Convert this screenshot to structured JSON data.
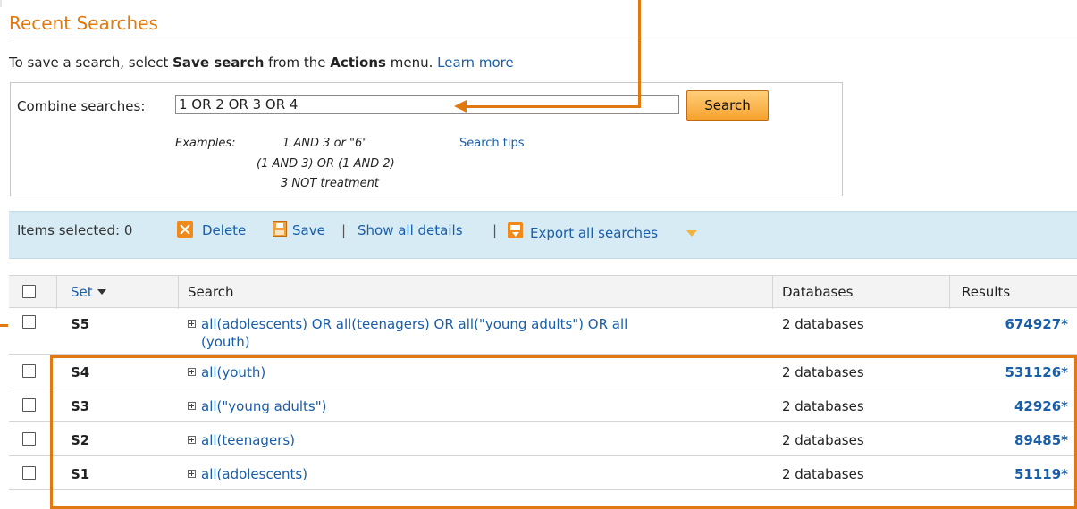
{
  "page": {
    "title": "Recent Searches",
    "intro": {
      "prefix": "To save a search, select ",
      "bold1": "Save search",
      "mid": " from the ",
      "bold2": "Actions",
      "suffix": " menu. ",
      "learn_more": "Learn more"
    }
  },
  "combine": {
    "label": "Combine searches:",
    "value": "1 OR 2 OR 3 OR 4",
    "search_button": "Search",
    "examples_label": "Examples:",
    "examples": [
      "1 AND 3 or \"6\"",
      "(1 AND 3) OR (1 AND 2)",
      "3 NOT treatment"
    ],
    "search_tips": "Search tips"
  },
  "toolbar": {
    "items_selected": "Items selected: 0",
    "delete": "Delete",
    "save": "Save",
    "separator": "|",
    "show_all_details": "Show all details",
    "export_all": "Export all searches"
  },
  "table": {
    "headers": {
      "set": "Set",
      "search": "Search",
      "databases": "Databases",
      "results": "Results"
    },
    "rows": [
      {
        "set": "S5",
        "search_line1": "all(adolescents) OR all(teenagers) OR all(\"young adults\") OR all",
        "search_line2": "(youth)",
        "databases": "2 databases",
        "results": "674927*"
      },
      {
        "set": "S4",
        "search_line1": "all(youth)",
        "search_line2": "",
        "databases": "2 databases",
        "results": "531126*"
      },
      {
        "set": "S3",
        "search_line1": "all(\"young adults\")",
        "search_line2": "",
        "databases": "2 databases",
        "results": "42926*"
      },
      {
        "set": "S2",
        "search_line1": "all(teenagers)",
        "search_line2": "",
        "databases": "2 databases",
        "results": "89485*"
      },
      {
        "set": "S1",
        "search_line1": "all(adolescents)",
        "search_line2": "",
        "databases": "2 databases",
        "results": "51119*"
      }
    ]
  },
  "colors": {
    "title": "#e07a10",
    "link": "#1a5ea8",
    "toolbar_bg": "#d6ebf4",
    "annotation": "#e07a10"
  }
}
